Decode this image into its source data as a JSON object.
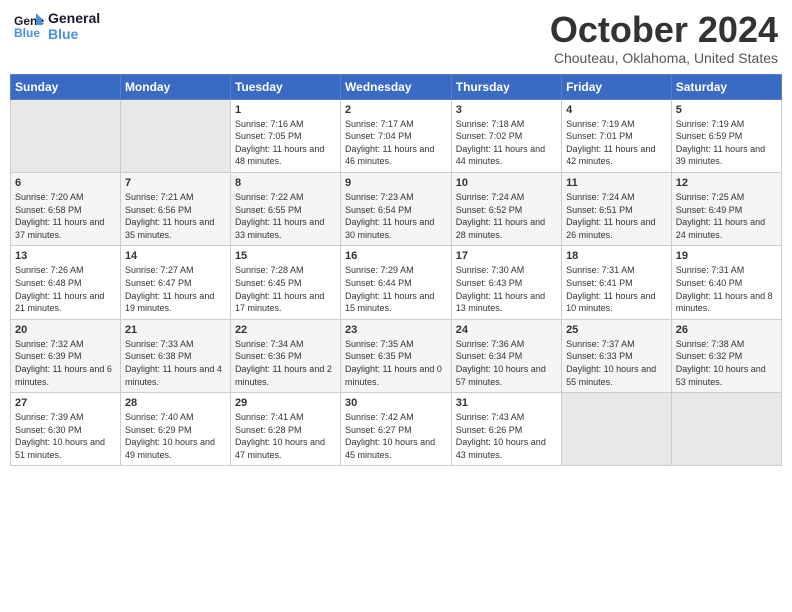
{
  "header": {
    "logo_line1": "General",
    "logo_line2": "Blue",
    "month": "October 2024",
    "location": "Chouteau, Oklahoma, United States"
  },
  "weekdays": [
    "Sunday",
    "Monday",
    "Tuesday",
    "Wednesday",
    "Thursday",
    "Friday",
    "Saturday"
  ],
  "weeks": [
    [
      {
        "day": "",
        "info": ""
      },
      {
        "day": "",
        "info": ""
      },
      {
        "day": "1",
        "info": "Sunrise: 7:16 AM\nSunset: 7:05 PM\nDaylight: 11 hours and 48 minutes."
      },
      {
        "day": "2",
        "info": "Sunrise: 7:17 AM\nSunset: 7:04 PM\nDaylight: 11 hours and 46 minutes."
      },
      {
        "day": "3",
        "info": "Sunrise: 7:18 AM\nSunset: 7:02 PM\nDaylight: 11 hours and 44 minutes."
      },
      {
        "day": "4",
        "info": "Sunrise: 7:19 AM\nSunset: 7:01 PM\nDaylight: 11 hours and 42 minutes."
      },
      {
        "day": "5",
        "info": "Sunrise: 7:19 AM\nSunset: 6:59 PM\nDaylight: 11 hours and 39 minutes."
      }
    ],
    [
      {
        "day": "6",
        "info": "Sunrise: 7:20 AM\nSunset: 6:58 PM\nDaylight: 11 hours and 37 minutes."
      },
      {
        "day": "7",
        "info": "Sunrise: 7:21 AM\nSunset: 6:56 PM\nDaylight: 11 hours and 35 minutes."
      },
      {
        "day": "8",
        "info": "Sunrise: 7:22 AM\nSunset: 6:55 PM\nDaylight: 11 hours and 33 minutes."
      },
      {
        "day": "9",
        "info": "Sunrise: 7:23 AM\nSunset: 6:54 PM\nDaylight: 11 hours and 30 minutes."
      },
      {
        "day": "10",
        "info": "Sunrise: 7:24 AM\nSunset: 6:52 PM\nDaylight: 11 hours and 28 minutes."
      },
      {
        "day": "11",
        "info": "Sunrise: 7:24 AM\nSunset: 6:51 PM\nDaylight: 11 hours and 26 minutes."
      },
      {
        "day": "12",
        "info": "Sunrise: 7:25 AM\nSunset: 6:49 PM\nDaylight: 11 hours and 24 minutes."
      }
    ],
    [
      {
        "day": "13",
        "info": "Sunrise: 7:26 AM\nSunset: 6:48 PM\nDaylight: 11 hours and 21 minutes."
      },
      {
        "day": "14",
        "info": "Sunrise: 7:27 AM\nSunset: 6:47 PM\nDaylight: 11 hours and 19 minutes."
      },
      {
        "day": "15",
        "info": "Sunrise: 7:28 AM\nSunset: 6:45 PM\nDaylight: 11 hours and 17 minutes."
      },
      {
        "day": "16",
        "info": "Sunrise: 7:29 AM\nSunset: 6:44 PM\nDaylight: 11 hours and 15 minutes."
      },
      {
        "day": "17",
        "info": "Sunrise: 7:30 AM\nSunset: 6:43 PM\nDaylight: 11 hours and 13 minutes."
      },
      {
        "day": "18",
        "info": "Sunrise: 7:31 AM\nSunset: 6:41 PM\nDaylight: 11 hours and 10 minutes."
      },
      {
        "day": "19",
        "info": "Sunrise: 7:31 AM\nSunset: 6:40 PM\nDaylight: 11 hours and 8 minutes."
      }
    ],
    [
      {
        "day": "20",
        "info": "Sunrise: 7:32 AM\nSunset: 6:39 PM\nDaylight: 11 hours and 6 minutes."
      },
      {
        "day": "21",
        "info": "Sunrise: 7:33 AM\nSunset: 6:38 PM\nDaylight: 11 hours and 4 minutes."
      },
      {
        "day": "22",
        "info": "Sunrise: 7:34 AM\nSunset: 6:36 PM\nDaylight: 11 hours and 2 minutes."
      },
      {
        "day": "23",
        "info": "Sunrise: 7:35 AM\nSunset: 6:35 PM\nDaylight: 11 hours and 0 minutes."
      },
      {
        "day": "24",
        "info": "Sunrise: 7:36 AM\nSunset: 6:34 PM\nDaylight: 10 hours and 57 minutes."
      },
      {
        "day": "25",
        "info": "Sunrise: 7:37 AM\nSunset: 6:33 PM\nDaylight: 10 hours and 55 minutes."
      },
      {
        "day": "26",
        "info": "Sunrise: 7:38 AM\nSunset: 6:32 PM\nDaylight: 10 hours and 53 minutes."
      }
    ],
    [
      {
        "day": "27",
        "info": "Sunrise: 7:39 AM\nSunset: 6:30 PM\nDaylight: 10 hours and 51 minutes."
      },
      {
        "day": "28",
        "info": "Sunrise: 7:40 AM\nSunset: 6:29 PM\nDaylight: 10 hours and 49 minutes."
      },
      {
        "day": "29",
        "info": "Sunrise: 7:41 AM\nSunset: 6:28 PM\nDaylight: 10 hours and 47 minutes."
      },
      {
        "day": "30",
        "info": "Sunrise: 7:42 AM\nSunset: 6:27 PM\nDaylight: 10 hours and 45 minutes."
      },
      {
        "day": "31",
        "info": "Sunrise: 7:43 AM\nSunset: 6:26 PM\nDaylight: 10 hours and 43 minutes."
      },
      {
        "day": "",
        "info": ""
      },
      {
        "day": "",
        "info": ""
      }
    ]
  ]
}
